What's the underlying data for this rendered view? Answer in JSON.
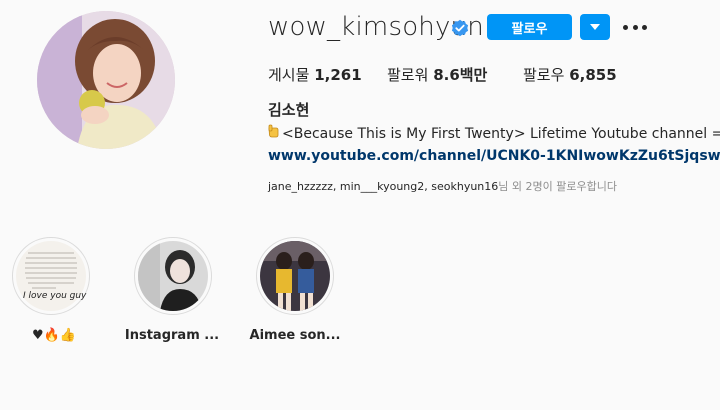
{
  "profile": {
    "username": "wow_kimsohyun",
    "follow_label": "팔로우",
    "stats": {
      "posts_label": "게시물",
      "posts_value": "1,261",
      "followers_label": "팔로워",
      "followers_value": "8.6백만",
      "following_label": "팔로우",
      "following_value": "6,855"
    },
    "full_name": "김소현",
    "bio": "<Because This is My First Twenty> Lifetime Youtube channel =) ♥",
    "website": "www.youtube.com/channel/UCNK0-1KNIwowKzZu6tSjqsw",
    "followed_by_names": "jane_hzzzzz, min___kyoung2, seokhyun16",
    "followed_by_suffix": "님 외 2명이 팔로우합니다"
  },
  "highlights": [
    {
      "label": "♥🔥👍",
      "cover_text": "I love you guy"
    },
    {
      "label": "Instagram ..."
    },
    {
      "label": "Aimee son..."
    }
  ],
  "colors": {
    "accent": "#0095f6",
    "link": "#00376b",
    "verified": "#3897f0"
  }
}
